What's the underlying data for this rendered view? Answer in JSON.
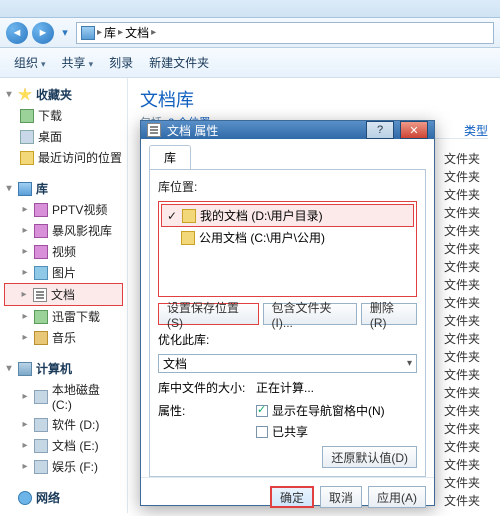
{
  "breadcrumb": {
    "seg1": "库",
    "seg2": "文档"
  },
  "toolbar": {
    "organize": "组织",
    "share": "共享",
    "burn": "刻录",
    "newfolder": "新建文件夹"
  },
  "sidebar": {
    "favorites": {
      "label": "收藏夹",
      "items": [
        "下载",
        "桌面",
        "最近访问的位置"
      ]
    },
    "libraries": {
      "label": "库",
      "items": [
        "PPTV视频",
        "暴风影视库",
        "视频",
        "图片",
        "文档",
        "迅雷下载",
        "音乐"
      ]
    },
    "computer": {
      "label": "计算机",
      "items": [
        "本地磁盘 (C:)",
        "软件 (D:)",
        "文档 (E:)",
        "娱乐 (F:)"
      ]
    },
    "network": {
      "label": "网络"
    }
  },
  "content": {
    "title": "文档库",
    "sub_prefix": "包括: ",
    "sub_count": "2 个位置",
    "col_type": "类型",
    "type_value": "文件夹"
  },
  "dialog": {
    "title": "文档 属性",
    "tab": "库",
    "loc_label": "库位置:",
    "locations": [
      {
        "checked": true,
        "name": "我的文档 (D:\\用户目录)"
      },
      {
        "checked": false,
        "name": "公用文档 (C:\\用户\\公用)"
      }
    ],
    "btn_set_save": "设置保存位置(S)",
    "btn_include": "包含文件夹(I)...",
    "btn_remove": "删除(R)",
    "optimize_label": "优化此库:",
    "optimize_value": "文档",
    "size_label": "库中文件的大小:",
    "size_value": "正在计算...",
    "attr_label": "属性:",
    "attr_nav": "显示在导航窗格中(N)",
    "attr_shared": "已共享",
    "btn_restore": "还原默认值(D)",
    "btn_ok": "确定",
    "btn_cancel": "取消",
    "btn_apply": "应用(A)"
  }
}
